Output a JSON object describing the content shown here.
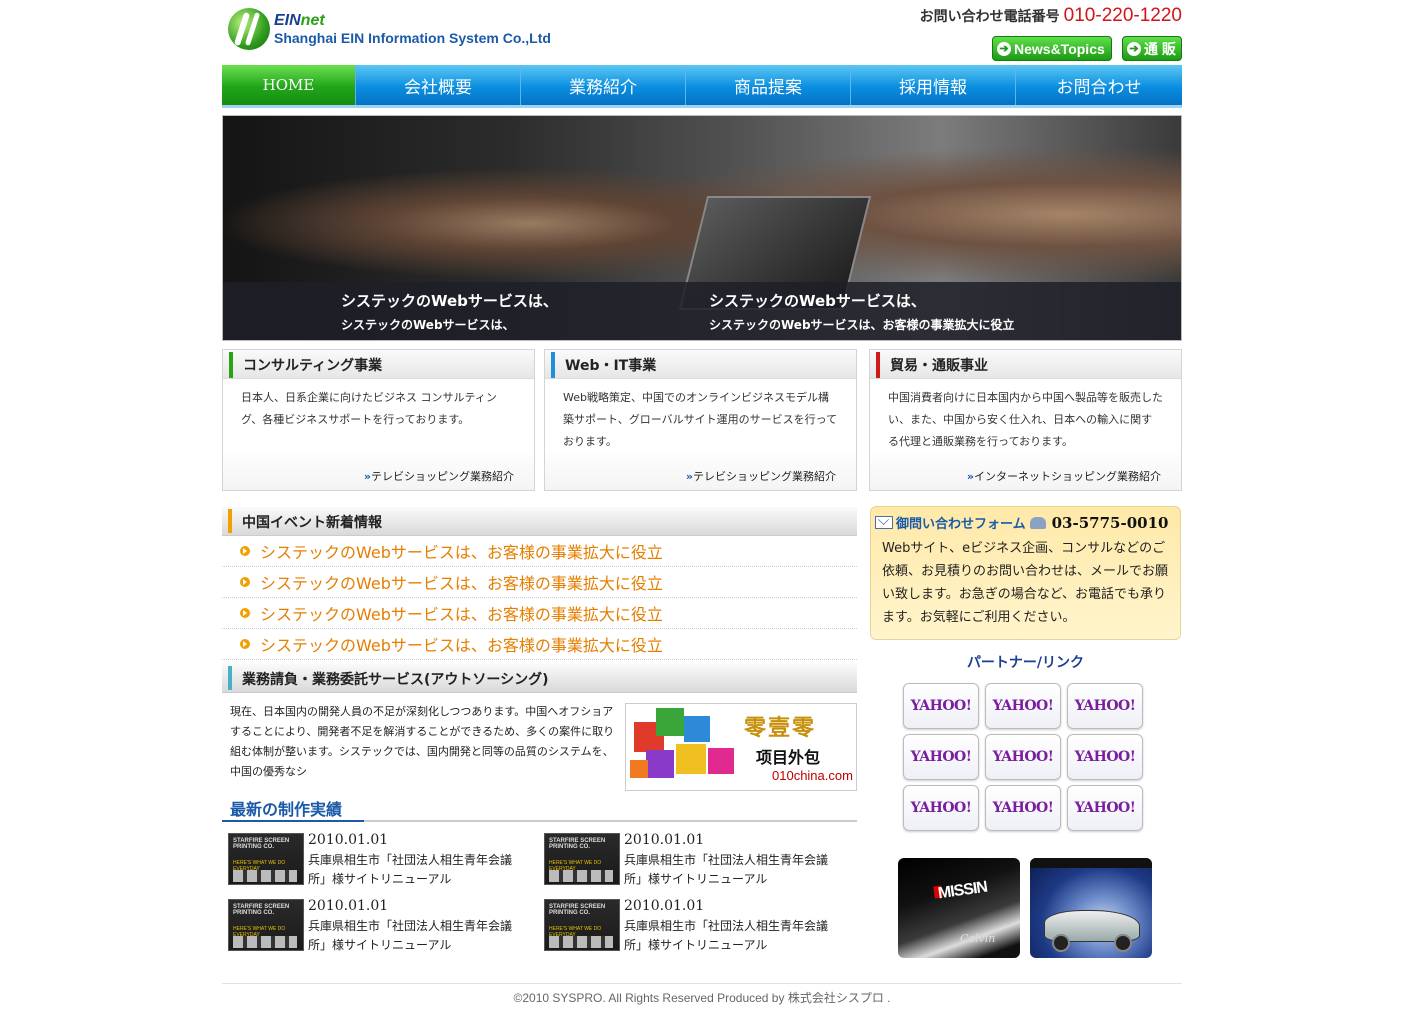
{
  "header": {
    "logo": {
      "brand_prefix": "EIN",
      "brand_suffix": "net",
      "company": "Shanghai EIN Information System Co.,Ltd"
    },
    "phone_label": "お問い合わせ電話番号",
    "phone_number": "010-220-1220",
    "news_button": "News&Topics",
    "tsuhan_button": "通 販"
  },
  "nav": [
    "HOME",
    "会社概要",
    "業務紹介",
    "商品提案",
    "採用情報",
    "お問合わせ"
  ],
  "hero": {
    "captions": [
      {
        "line1": "システックのWebサービスは、",
        "line2": "システックのWebサービスは、"
      },
      {
        "line1": "システックのWebサービスは、",
        "line2": "システックのWebサービスは、お客様の事業拡大に役立"
      }
    ]
  },
  "services": [
    {
      "title": "コンサルティング事業",
      "accent": "#2aa214",
      "body": "日本人、日系企業に向けたビジネス コンサルティング、各種ビジネスサポートを行っております。",
      "link": "テレビショッピング業務紹介"
    },
    {
      "title": "Web・IT事業",
      "accent": "#1e8fd8",
      "body": "Web戦略策定、中国でのオンラインビジネスモデル構築サポート、グローバルサイト運用のサービスを行っております。",
      "link": "テレビショッピング業務紹介"
    },
    {
      "title": "貿易・通販事业",
      "accent": "#d01a1a",
      "body": "中国消費者向けに日本国内から中国へ製品等を販売したい、また、中国から安く仕入れ、日本への輸入に関する代理と通販業務を行っております。",
      "link": "インターネットショッピング業務紹介"
    }
  ],
  "events": {
    "title": "中国イベント新着情報",
    "accent": "#f0a000",
    "items": [
      "システックのWebサービスは、お客様の事業拡大に役立",
      "システックのWebサービスは、お客様の事業拡大に役立",
      "システックのWebサービスは、お客様の事業拡大に役立",
      "システックのWebサービスは、お客様の事業拡大に役立"
    ]
  },
  "outsource": {
    "title": "業務請負・業務委託サービス(アウトソーシング)",
    "accent": "#4ab0c8",
    "body": "現在、日本国内の開発人員の不足が深刻化しつつあります。中国へオフショアすることにより、開発者不足を解消することができるため、多くの案件に取り組む体制が整います。システックでは、国内開発と同等の品質のシステムを、中国の優秀なシ",
    "banner": {
      "title": "零壹零",
      "subtitle": "项目外包",
      "url": "010china.com"
    }
  },
  "works": {
    "title": "最新の制作実績",
    "items": [
      {
        "date": "2010.01.01",
        "desc": "兵庫県相生市「社団法人相生青年会議所」様サイトリニューアル",
        "thumb_top": "STARFIRE SCREEN PRINTING CO.",
        "thumb_mid": "HERE'S WHAT WE DO EVERYDAY"
      },
      {
        "date": "2010.01.01",
        "desc": "兵庫県相生市「社団法人相生青年会議所」様サイトリニューアル",
        "thumb_top": "STARFIRE SCREEN PRINTING CO.",
        "thumb_mid": "HERE'S WHAT WE DO EVERYDAY"
      },
      {
        "date": "2010.01.01",
        "desc": "兵庫県相生市「社団法人相生青年会議所」様サイトリニューアル",
        "thumb_top": "STARFIRE SCREEN PRINTING CO.",
        "thumb_mid": "HERE'S WHAT WE DO EVERYDAY"
      },
      {
        "date": "2010.01.01",
        "desc": "兵庫県相生市「社団法人相生青年会議所」様サイトリニューアル",
        "thumb_top": "STARFIRE SCREEN PRINTING CO.",
        "thumb_mid": "HERE'S WHAT WE DO EVERYDAY"
      }
    ]
  },
  "contact": {
    "form_label": "御問い合わせフォーム",
    "phone": "03-5775-0010",
    "body": "Webサイト、eビジネス企画、コンサルなどのご依頼、お見積りのお問い合わせは、メールでお願い致します。お急ぎの場合など、お電話でも承ります。お気軽にご利用ください。"
  },
  "partners": {
    "title": "パートナー/リンク",
    "logos": [
      "YAHOO!",
      "YAHOO!",
      "YAHOO!",
      "YAHOO!",
      "YAHOO!",
      "YAHOO!",
      "YAHOO!",
      "YAHOO!",
      "YAHOO!"
    ]
  },
  "promos": {
    "left_text": "MISSIN",
    "left_sig": "Calvin"
  },
  "footer": "©2010 SYSPRO. All Rights Reserved Produced by 株式会社シスプロ ."
}
